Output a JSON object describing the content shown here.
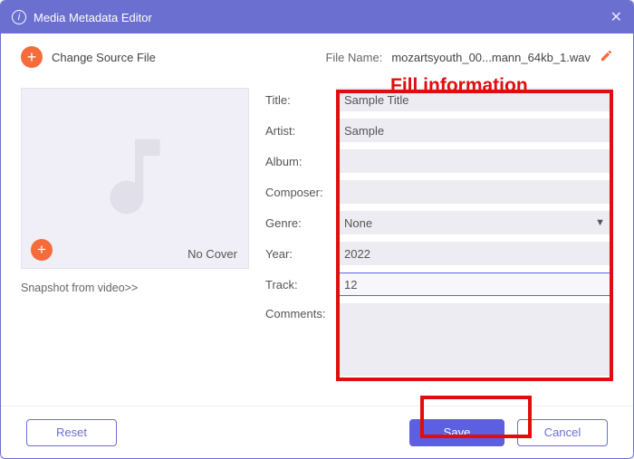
{
  "window": {
    "title": "Media Metadata Editor"
  },
  "toolbar": {
    "change_source": "Change Source File",
    "filename_label": "File Name:",
    "filename_value": "mozartsyouth_00...mann_64kb_1.wav"
  },
  "cover": {
    "no_cover": "No Cover",
    "snapshot": "Snapshot from video>>"
  },
  "annotation": "Fill information",
  "form": {
    "labels": {
      "title": "Title:",
      "artist": "Artist:",
      "album": "Album:",
      "composer": "Composer:",
      "genre": "Genre:",
      "year": "Year:",
      "track": "Track:",
      "comments": "Comments:"
    },
    "values": {
      "title": "Sample Title",
      "artist": "Sample",
      "album": "",
      "composer": "",
      "genre": "None",
      "year": "2022",
      "track": "12",
      "comments": ""
    }
  },
  "buttons": {
    "reset": "Reset",
    "save": "Save",
    "cancel": "Cancel"
  }
}
